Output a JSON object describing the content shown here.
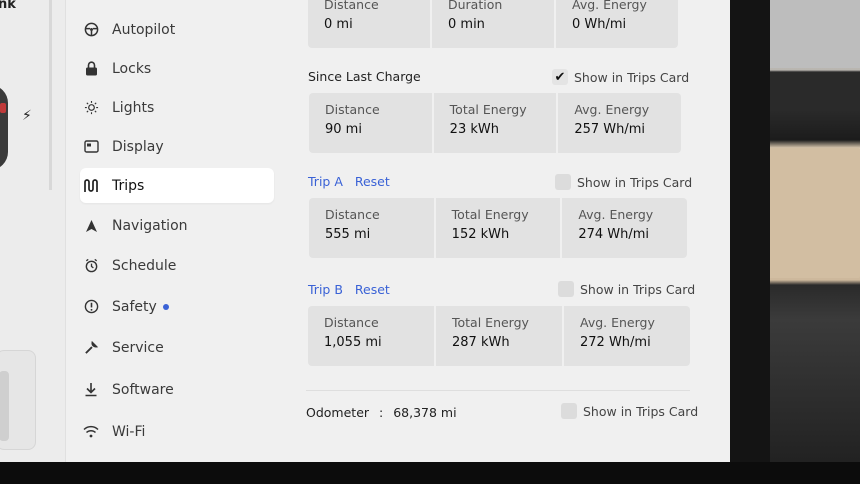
{
  "left_panel": {
    "cut_label": "nk"
  },
  "nav": {
    "items": [
      {
        "label": "Autopilot",
        "icon": "steering-wheel-icon"
      },
      {
        "label": "Locks",
        "icon": "lock-icon"
      },
      {
        "label": "Lights",
        "icon": "light-icon"
      },
      {
        "label": "Display",
        "icon": "display-icon"
      },
      {
        "label": "Trips",
        "icon": "trips-icon",
        "active": true
      },
      {
        "label": "Navigation",
        "icon": "navigation-icon"
      },
      {
        "label": "Schedule",
        "icon": "clock-icon"
      },
      {
        "label": "Safety",
        "icon": "warning-icon",
        "badge": true
      },
      {
        "label": "Service",
        "icon": "wrench-icon"
      },
      {
        "label": "Software",
        "icon": "download-icon"
      },
      {
        "label": "Wi-Fi",
        "icon": "wifi-icon"
      }
    ]
  },
  "current_drive": {
    "cells": [
      {
        "label": "Distance",
        "value": "0 mi"
      },
      {
        "label": "Duration",
        "value": "0 min"
      },
      {
        "label": "Avg. Energy",
        "value": "0 Wh/mi"
      }
    ]
  },
  "since_last_charge": {
    "title": "Since Last Charge",
    "show_label": "Show in Trips Card",
    "checked": true,
    "check_glyph": "✔",
    "cells": [
      {
        "label": "Distance",
        "value": "90 mi"
      },
      {
        "label": "Total Energy",
        "value": "23 kWh"
      },
      {
        "label": "Avg. Energy",
        "value": "257 Wh/mi"
      }
    ]
  },
  "trip_a": {
    "title": "Trip A",
    "reset": "Reset",
    "show_label": "Show in Trips Card",
    "checked": false,
    "cells": [
      {
        "label": "Distance",
        "value": "555 mi"
      },
      {
        "label": "Total Energy",
        "value": "152 kWh"
      },
      {
        "label": "Avg. Energy",
        "value": "274 Wh/mi"
      }
    ]
  },
  "trip_b": {
    "title": "Trip B",
    "reset": "Reset",
    "show_label": "Show in Trips Card",
    "checked": false,
    "cells": [
      {
        "label": "Distance",
        "value": "1,055 mi"
      },
      {
        "label": "Total Energy",
        "value": "287 kWh"
      },
      {
        "label": "Avg. Energy",
        "value": "272 Wh/mi"
      }
    ]
  },
  "odometer": {
    "label": "Odometer",
    "separator": ":",
    "value": "68,378 mi",
    "show_label": "Show in Trips Card",
    "checked": false
  },
  "colors": {
    "accent": "#3a62d6",
    "background": "#f0f0f0",
    "stat_bg": "#e2e2e2"
  }
}
